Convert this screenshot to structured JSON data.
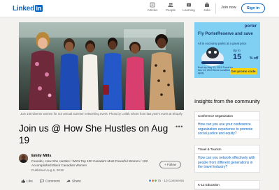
{
  "nav": {
    "logo_text": "Linked",
    "logo_badge": "in",
    "items": [
      {
        "label": "Articles",
        "icon": "articles-icon"
      },
      {
        "label": "People",
        "icon": "people-icon"
      },
      {
        "label": "Learning",
        "icon": "learning-icon"
      },
      {
        "label": "Jobs",
        "icon": "jobs-icon"
      }
    ],
    "join_label": "Join now",
    "signin_label": "Sign in"
  },
  "article": {
    "hero_caption": "Join 150 diverse women for our annual summer networking event. Photo by Leilah Ghore from last year's event at Shopify",
    "title": "Join us @ How She Hustles on Aug 19",
    "more_label": "•••",
    "author_name": "Emily Mills",
    "author_headline": "Founder, How She Hustles / WXN Top 100 Canada's Most Powerful Women / 100 Accomplished Black Canadian Women",
    "published": "Published Aug 6, 2019",
    "follow_label": "+ Follow",
    "actions": {
      "like": "Like",
      "comment": "Comment",
      "share": "Share"
    },
    "reactions_count": "75",
    "comments_count": "10 Comments"
  },
  "ad": {
    "brand": "porter",
    "headline": "Fly PorterReserve and save",
    "subline": "All in economy parks at a great price",
    "up_to": "Up to",
    "percent": "15",
    "off": "% off",
    "dates": "Book by May 13, 2019 Travel by Dec 13, 2019 Some conditions apply",
    "cta": "Get promo code"
  },
  "insights": {
    "heading": "Insights from the community",
    "cards": [
      {
        "tag": "Conference Organization",
        "question": "How can you use your conference organization experience to promote social justice and equity?"
      },
      {
        "tag": "Travel & Tourism",
        "question": "How can you network effectively with people from different generations in the travel industry?"
      },
      {
        "tag": "K-12 Education",
        "question": ""
      }
    ]
  },
  "colors": {
    "brand": "#0a66c2",
    "ad_background": "#7fd0f2",
    "ad_cta": "#ffd400"
  }
}
